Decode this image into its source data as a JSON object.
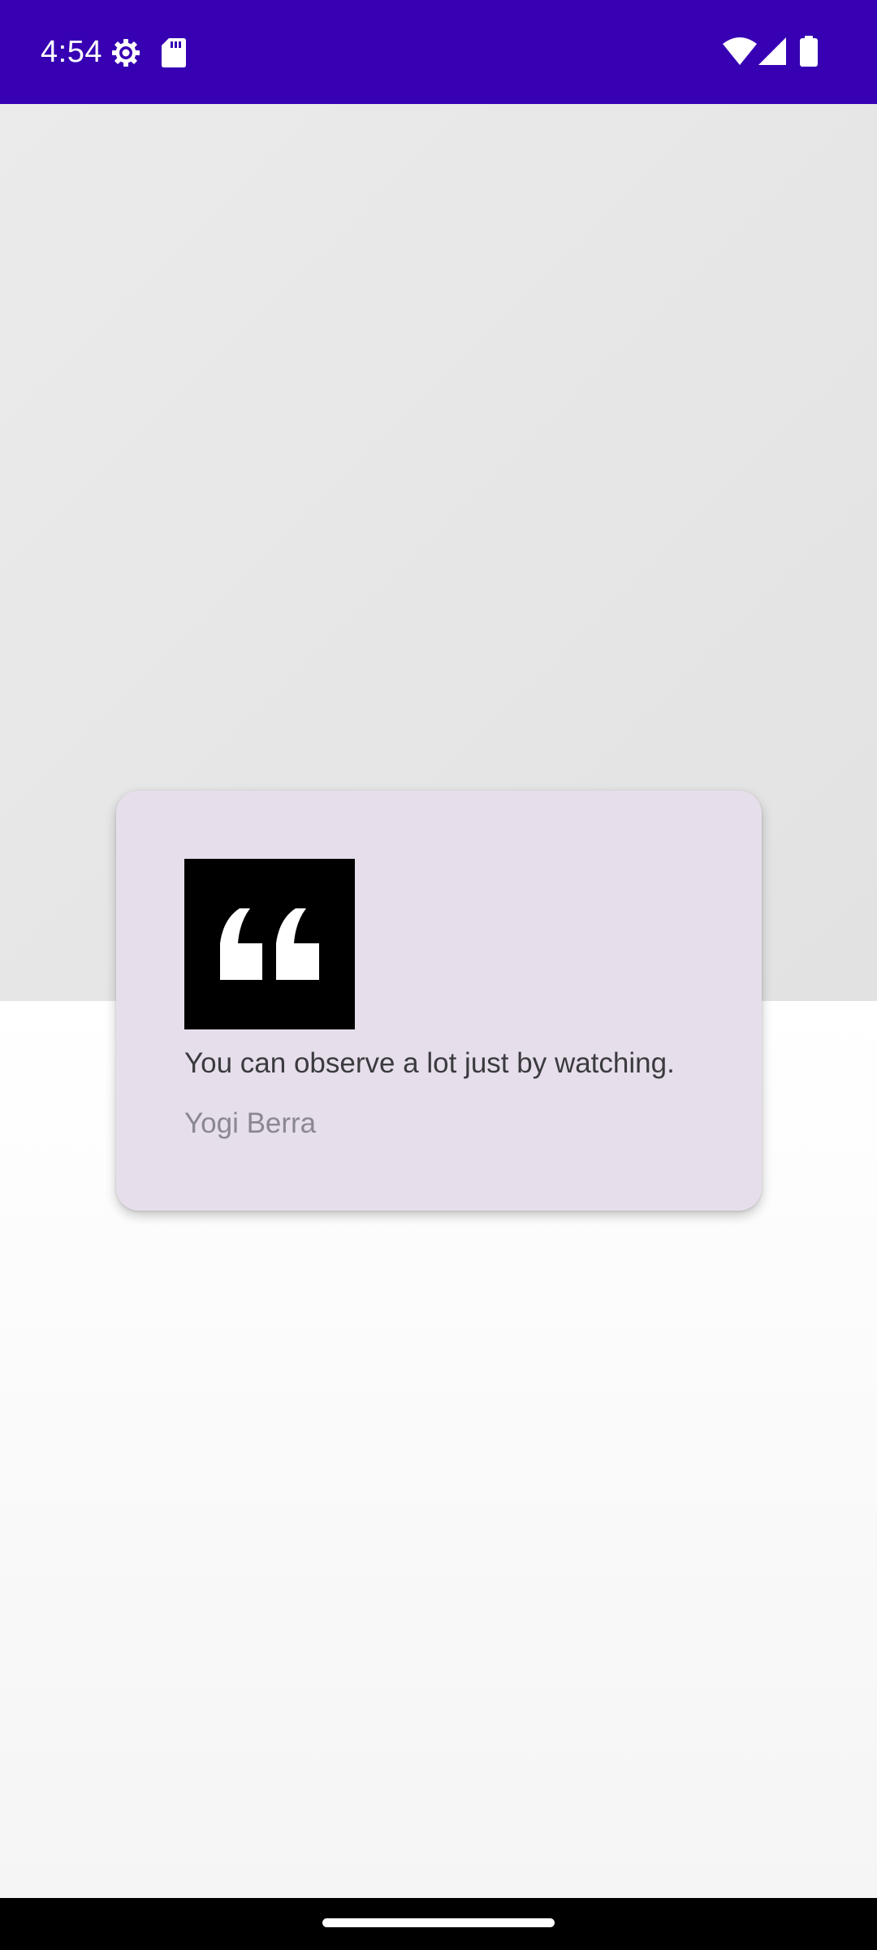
{
  "status_bar": {
    "time": "4:54",
    "background": "#3700b3",
    "left_icons": [
      "settings-icon",
      "sd-card-icon"
    ],
    "right_icons": [
      "wifi-icon",
      "cell-signal-icon",
      "battery-icon"
    ]
  },
  "quote_card": {
    "icon": "quote-mark-icon",
    "text": "You can observe a lot just by watching.",
    "author": "Yogi Berra",
    "background": "#e6dfeb"
  },
  "navigation": {
    "handle": "home-gesture-handle"
  }
}
